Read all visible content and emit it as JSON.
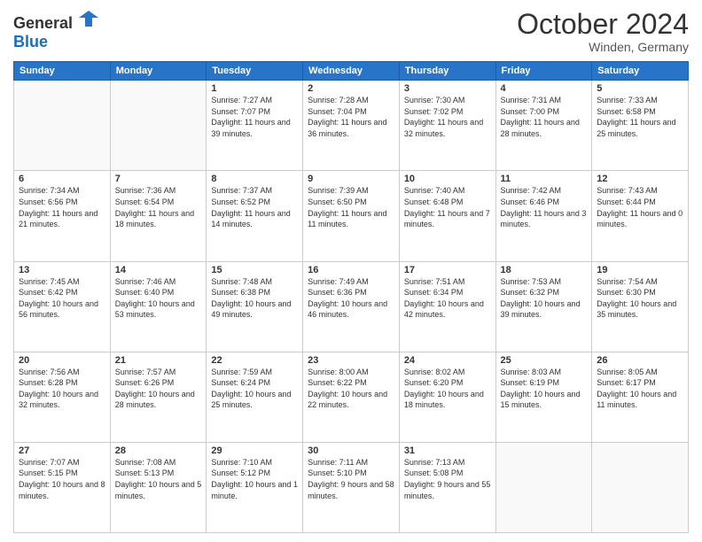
{
  "header": {
    "logo_general": "General",
    "logo_blue": "Blue",
    "month": "October 2024",
    "location": "Winden, Germany"
  },
  "days_of_week": [
    "Sunday",
    "Monday",
    "Tuesday",
    "Wednesday",
    "Thursday",
    "Friday",
    "Saturday"
  ],
  "weeks": [
    [
      {
        "day": "",
        "sunrise": "",
        "sunset": "",
        "daylight": ""
      },
      {
        "day": "",
        "sunrise": "",
        "sunset": "",
        "daylight": ""
      },
      {
        "day": "1",
        "sunrise": "Sunrise: 7:27 AM",
        "sunset": "Sunset: 7:07 PM",
        "daylight": "Daylight: 11 hours and 39 minutes."
      },
      {
        "day": "2",
        "sunrise": "Sunrise: 7:28 AM",
        "sunset": "Sunset: 7:04 PM",
        "daylight": "Daylight: 11 hours and 36 minutes."
      },
      {
        "day": "3",
        "sunrise": "Sunrise: 7:30 AM",
        "sunset": "Sunset: 7:02 PM",
        "daylight": "Daylight: 11 hours and 32 minutes."
      },
      {
        "day": "4",
        "sunrise": "Sunrise: 7:31 AM",
        "sunset": "Sunset: 7:00 PM",
        "daylight": "Daylight: 11 hours and 28 minutes."
      },
      {
        "day": "5",
        "sunrise": "Sunrise: 7:33 AM",
        "sunset": "Sunset: 6:58 PM",
        "daylight": "Daylight: 11 hours and 25 minutes."
      }
    ],
    [
      {
        "day": "6",
        "sunrise": "Sunrise: 7:34 AM",
        "sunset": "Sunset: 6:56 PM",
        "daylight": "Daylight: 11 hours and 21 minutes."
      },
      {
        "day": "7",
        "sunrise": "Sunrise: 7:36 AM",
        "sunset": "Sunset: 6:54 PM",
        "daylight": "Daylight: 11 hours and 18 minutes."
      },
      {
        "day": "8",
        "sunrise": "Sunrise: 7:37 AM",
        "sunset": "Sunset: 6:52 PM",
        "daylight": "Daylight: 11 hours and 14 minutes."
      },
      {
        "day": "9",
        "sunrise": "Sunrise: 7:39 AM",
        "sunset": "Sunset: 6:50 PM",
        "daylight": "Daylight: 11 hours and 11 minutes."
      },
      {
        "day": "10",
        "sunrise": "Sunrise: 7:40 AM",
        "sunset": "Sunset: 6:48 PM",
        "daylight": "Daylight: 11 hours and 7 minutes."
      },
      {
        "day": "11",
        "sunrise": "Sunrise: 7:42 AM",
        "sunset": "Sunset: 6:46 PM",
        "daylight": "Daylight: 11 hours and 3 minutes."
      },
      {
        "day": "12",
        "sunrise": "Sunrise: 7:43 AM",
        "sunset": "Sunset: 6:44 PM",
        "daylight": "Daylight: 11 hours and 0 minutes."
      }
    ],
    [
      {
        "day": "13",
        "sunrise": "Sunrise: 7:45 AM",
        "sunset": "Sunset: 6:42 PM",
        "daylight": "Daylight: 10 hours and 56 minutes."
      },
      {
        "day": "14",
        "sunrise": "Sunrise: 7:46 AM",
        "sunset": "Sunset: 6:40 PM",
        "daylight": "Daylight: 10 hours and 53 minutes."
      },
      {
        "day": "15",
        "sunrise": "Sunrise: 7:48 AM",
        "sunset": "Sunset: 6:38 PM",
        "daylight": "Daylight: 10 hours and 49 minutes."
      },
      {
        "day": "16",
        "sunrise": "Sunrise: 7:49 AM",
        "sunset": "Sunset: 6:36 PM",
        "daylight": "Daylight: 10 hours and 46 minutes."
      },
      {
        "day": "17",
        "sunrise": "Sunrise: 7:51 AM",
        "sunset": "Sunset: 6:34 PM",
        "daylight": "Daylight: 10 hours and 42 minutes."
      },
      {
        "day": "18",
        "sunrise": "Sunrise: 7:53 AM",
        "sunset": "Sunset: 6:32 PM",
        "daylight": "Daylight: 10 hours and 39 minutes."
      },
      {
        "day": "19",
        "sunrise": "Sunrise: 7:54 AM",
        "sunset": "Sunset: 6:30 PM",
        "daylight": "Daylight: 10 hours and 35 minutes."
      }
    ],
    [
      {
        "day": "20",
        "sunrise": "Sunrise: 7:56 AM",
        "sunset": "Sunset: 6:28 PM",
        "daylight": "Daylight: 10 hours and 32 minutes."
      },
      {
        "day": "21",
        "sunrise": "Sunrise: 7:57 AM",
        "sunset": "Sunset: 6:26 PM",
        "daylight": "Daylight: 10 hours and 28 minutes."
      },
      {
        "day": "22",
        "sunrise": "Sunrise: 7:59 AM",
        "sunset": "Sunset: 6:24 PM",
        "daylight": "Daylight: 10 hours and 25 minutes."
      },
      {
        "day": "23",
        "sunrise": "Sunrise: 8:00 AM",
        "sunset": "Sunset: 6:22 PM",
        "daylight": "Daylight: 10 hours and 22 minutes."
      },
      {
        "day": "24",
        "sunrise": "Sunrise: 8:02 AM",
        "sunset": "Sunset: 6:20 PM",
        "daylight": "Daylight: 10 hours and 18 minutes."
      },
      {
        "day": "25",
        "sunrise": "Sunrise: 8:03 AM",
        "sunset": "Sunset: 6:19 PM",
        "daylight": "Daylight: 10 hours and 15 minutes."
      },
      {
        "day": "26",
        "sunrise": "Sunrise: 8:05 AM",
        "sunset": "Sunset: 6:17 PM",
        "daylight": "Daylight: 10 hours and 11 minutes."
      }
    ],
    [
      {
        "day": "27",
        "sunrise": "Sunrise: 7:07 AM",
        "sunset": "Sunset: 5:15 PM",
        "daylight": "Daylight: 10 hours and 8 minutes."
      },
      {
        "day": "28",
        "sunrise": "Sunrise: 7:08 AM",
        "sunset": "Sunset: 5:13 PM",
        "daylight": "Daylight: 10 hours and 5 minutes."
      },
      {
        "day": "29",
        "sunrise": "Sunrise: 7:10 AM",
        "sunset": "Sunset: 5:12 PM",
        "daylight": "Daylight: 10 hours and 1 minute."
      },
      {
        "day": "30",
        "sunrise": "Sunrise: 7:11 AM",
        "sunset": "Sunset: 5:10 PM",
        "daylight": "Daylight: 9 hours and 58 minutes."
      },
      {
        "day": "31",
        "sunrise": "Sunrise: 7:13 AM",
        "sunset": "Sunset: 5:08 PM",
        "daylight": "Daylight: 9 hours and 55 minutes."
      },
      {
        "day": "",
        "sunrise": "",
        "sunset": "",
        "daylight": ""
      },
      {
        "day": "",
        "sunrise": "",
        "sunset": "",
        "daylight": ""
      }
    ]
  ]
}
